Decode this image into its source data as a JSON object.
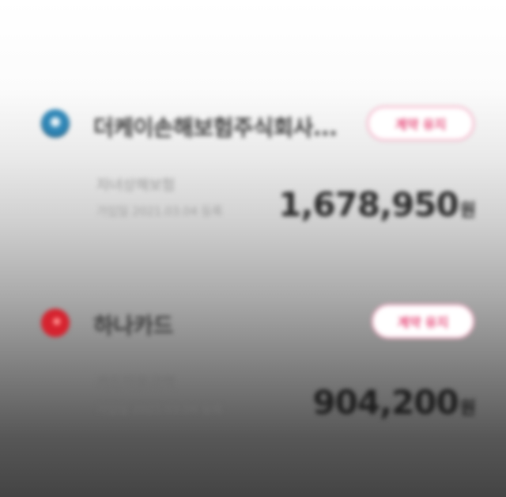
{
  "cards": [
    {
      "logo_icon": "insurance-company-logo-icon",
      "company_name": "더케이손해보험주식회사...",
      "status_badge": "계약 유지",
      "sub_label": "자녀상해보험",
      "sub_detail": "가입일 2021.03.04 등록",
      "amount": "1,678,950",
      "unit": "원"
    },
    {
      "logo_icon": "card-company-logo-icon",
      "company_name": "하나카드",
      "status_badge": "계약 유지",
      "sub_label": "카드이용금액",
      "sub_detail": "가입일 2021.03.04 등록",
      "amount": "904,200",
      "unit": "원"
    }
  ],
  "colors": {
    "badge_text": "#e64b7a",
    "badge_border": "#f4a3bd",
    "logo_1": "#2f86b6",
    "logo_2": "#d6232f"
  }
}
